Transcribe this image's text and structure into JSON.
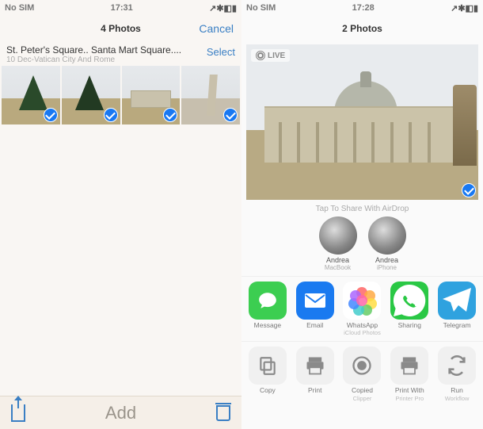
{
  "left": {
    "status": {
      "sim": "No SIM",
      "time": "17:31"
    },
    "nav": {
      "count": "4 Photos",
      "cancel": "Cancel"
    },
    "moment": {
      "title": "St. Peter's Square.. Santa Mart Square....",
      "subtitle": "10 Dec-Vatican City And Rome",
      "select": "Select"
    },
    "bottom": {
      "add": "Add"
    }
  },
  "right": {
    "status": {
      "sim": "No SIM",
      "time": "17:28"
    },
    "nav": {
      "count": "2 Photos"
    },
    "live": "LIVE",
    "airdrop": {
      "title": "Tap To Share With AirDrop",
      "contacts": [
        {
          "name": "Andrea",
          "device": "MacBook"
        },
        {
          "name": "Andrea",
          "device": "iPhone"
        }
      ]
    },
    "apps": [
      {
        "label": "Message",
        "sublabel": ""
      },
      {
        "label": "Email",
        "sublabel": ""
      },
      {
        "label": "WhatsApp",
        "sublabel": "iCloud Photos"
      },
      {
        "label": "Sharing",
        "sublabel": ""
      },
      {
        "label": "Telegram",
        "sublabel": ""
      }
    ],
    "actions": [
      {
        "label": "Copy",
        "sublabel": ""
      },
      {
        "label": "Print",
        "sublabel": ""
      },
      {
        "label": "Copied",
        "sublabel": "Clipper"
      },
      {
        "label": "Print With",
        "sublabel": "Printer Pro"
      },
      {
        "label": "Run",
        "sublabel": "Workflow"
      }
    ]
  }
}
